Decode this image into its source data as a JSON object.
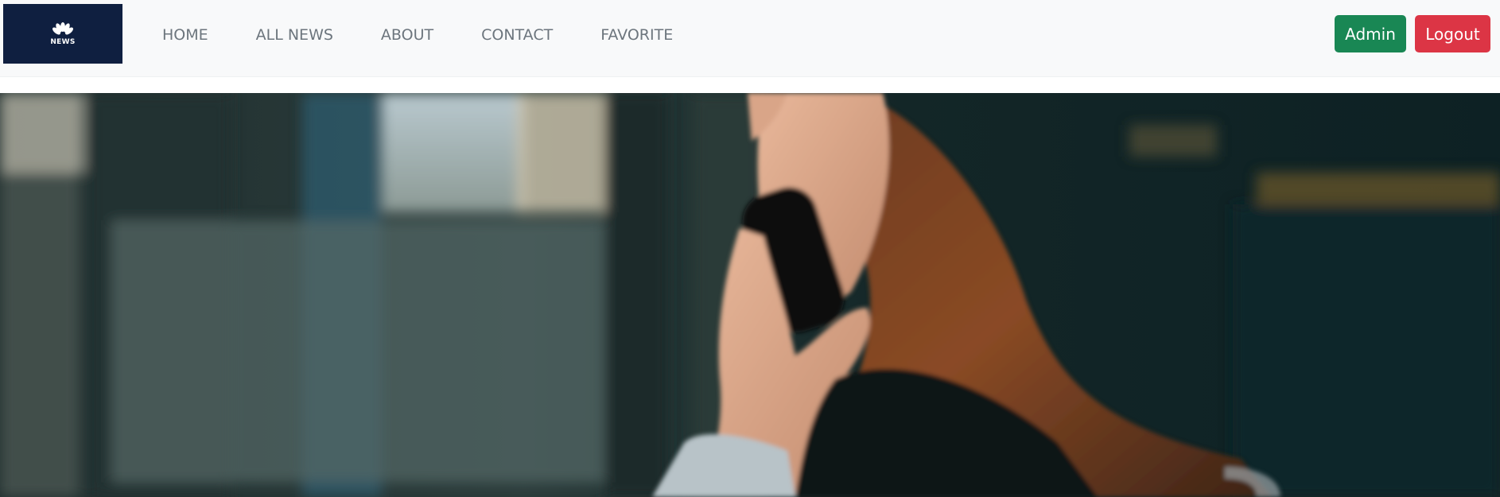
{
  "brand": {
    "logo_text": "NEWS",
    "icon": "peacock-icon"
  },
  "nav": {
    "items": [
      {
        "label": "HOME"
      },
      {
        "label": "ALL NEWS"
      },
      {
        "label": "ABOUT"
      },
      {
        "label": "CONTACT"
      },
      {
        "label": "FAVORITE"
      }
    ]
  },
  "actions": {
    "admin_label": "Admin",
    "logout_label": "Logout"
  },
  "colors": {
    "brand_bg": "#0f1f40",
    "admin": "#198754",
    "logout": "#dc3545",
    "nav_text": "#6c757d"
  },
  "hero": {
    "image": "woman-on-phone-photo"
  }
}
